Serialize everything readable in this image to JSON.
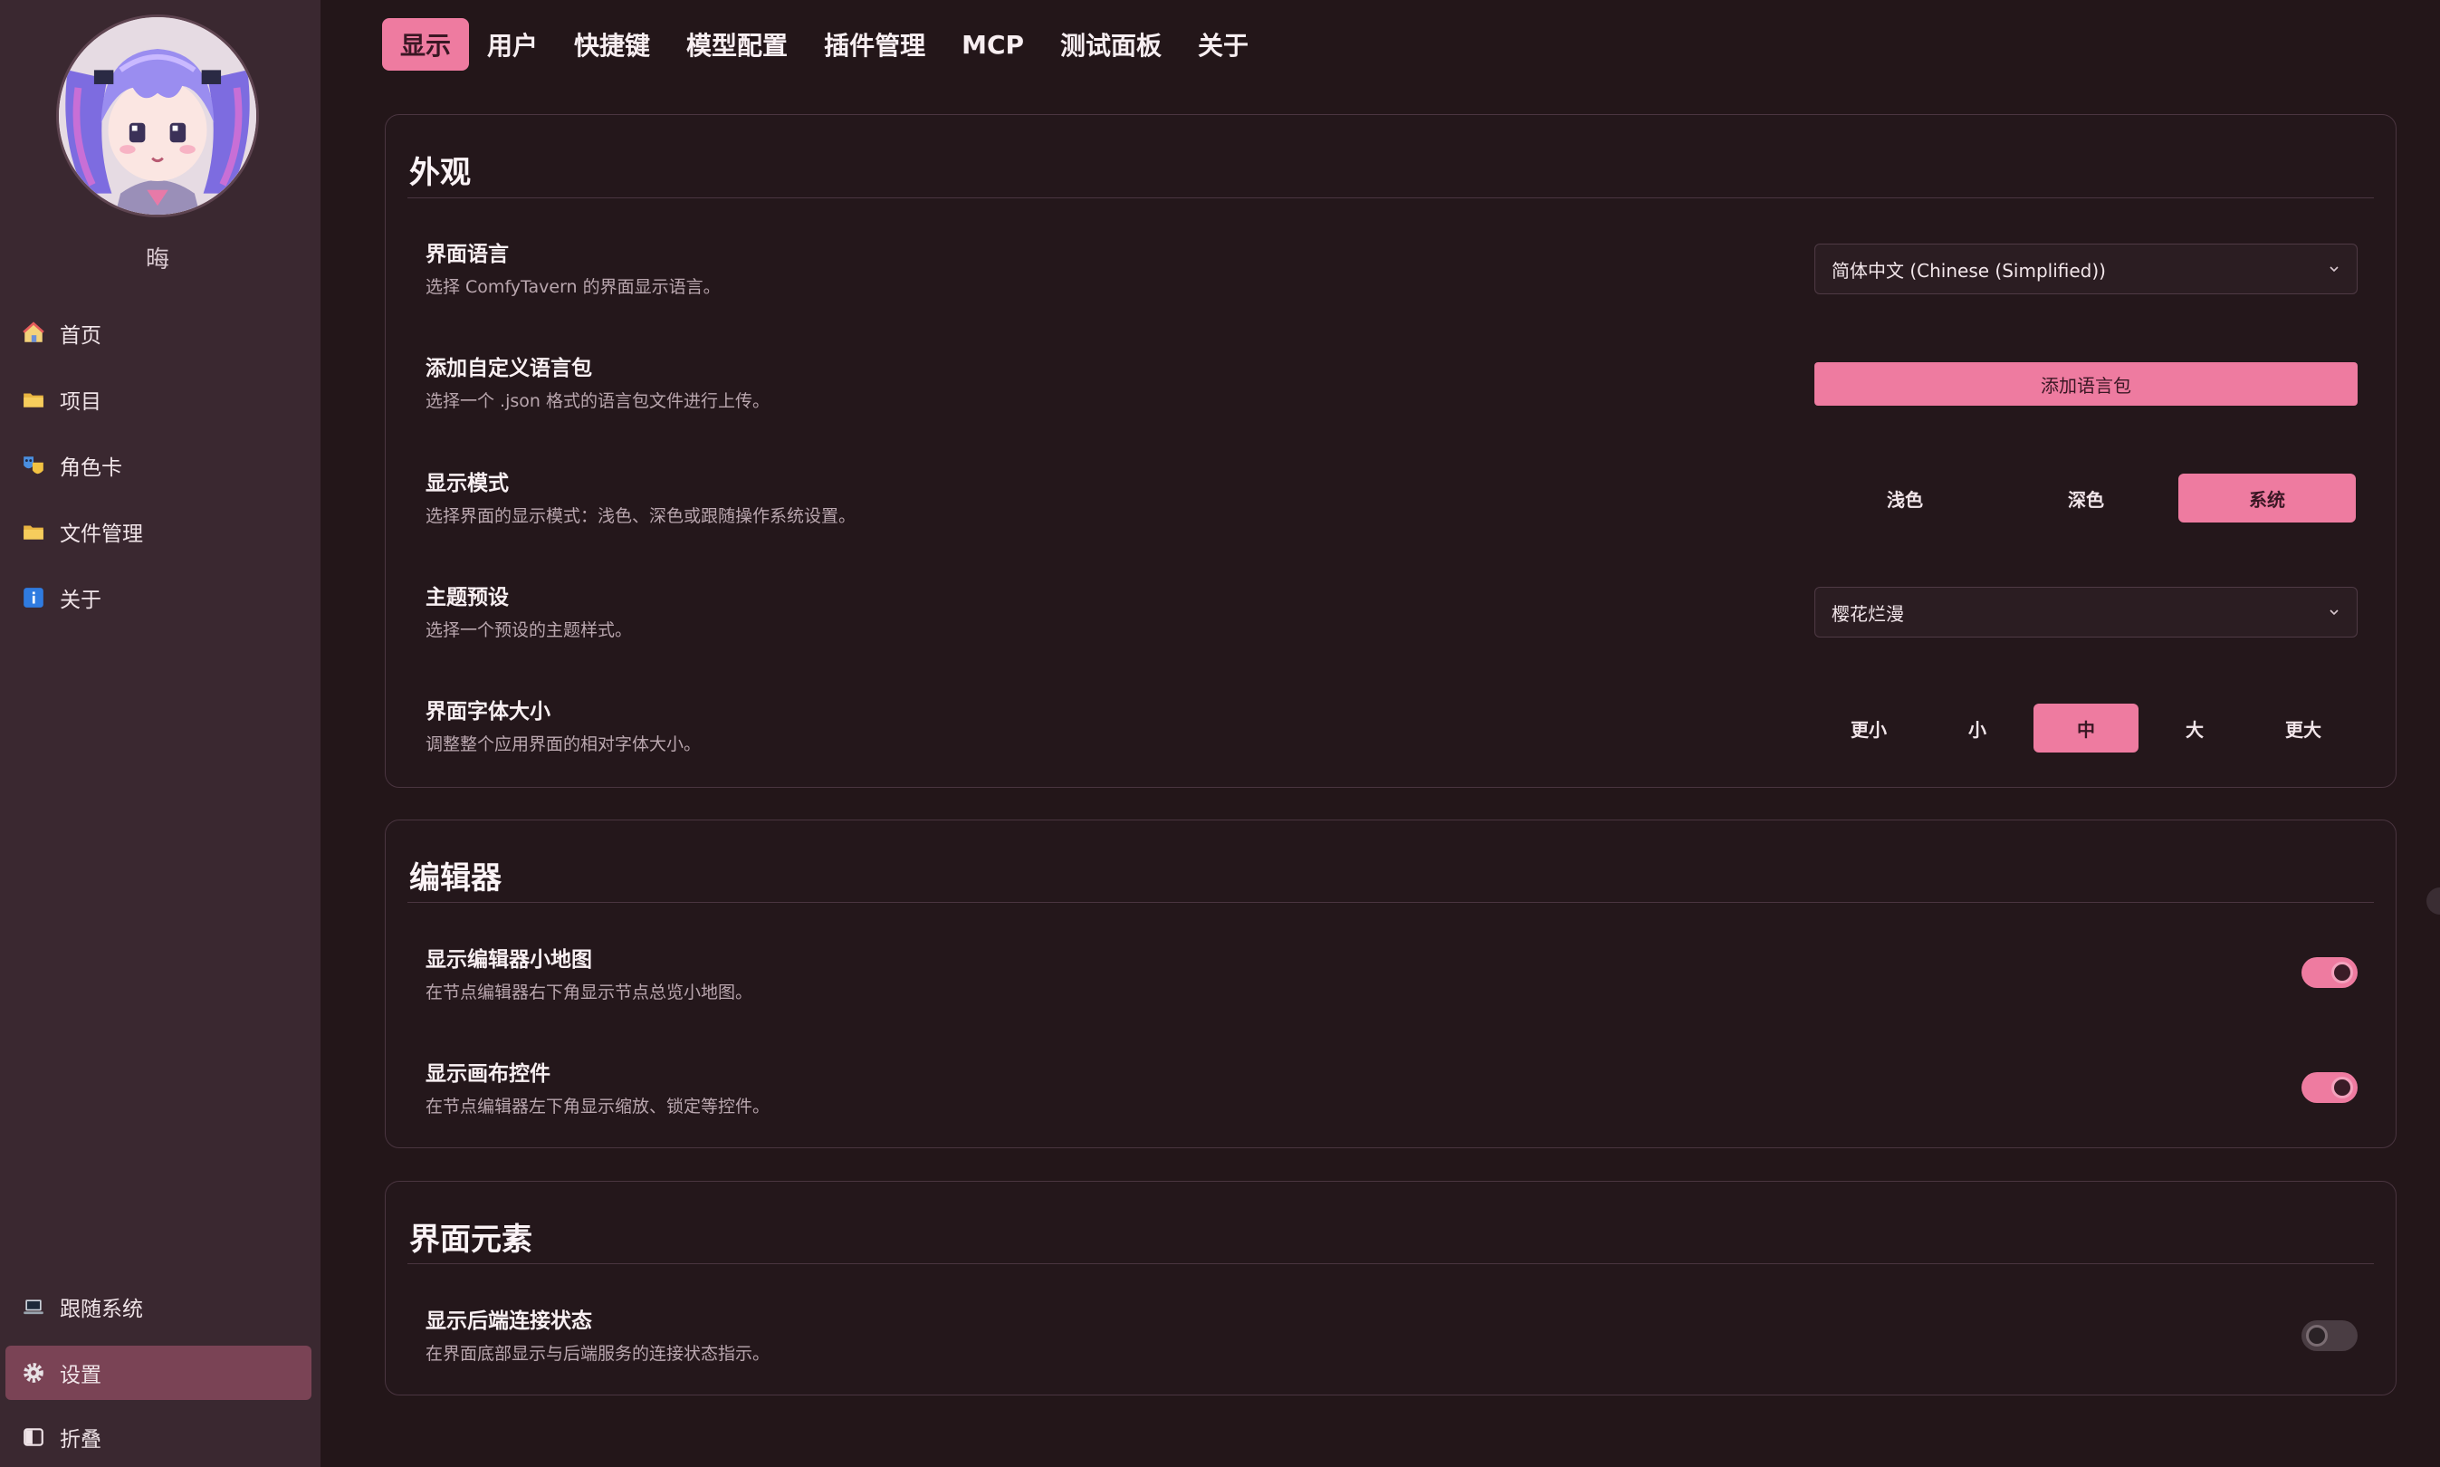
{
  "colors": {
    "accent": "#ee7ba0",
    "sidebar_bg": "#3a2830",
    "page_bg": "#231619",
    "active_nav_bg": "#7a4355"
  },
  "sidebar": {
    "username": "晦",
    "items": [
      {
        "label": "首页",
        "icon": "home-icon"
      },
      {
        "label": "项目",
        "icon": "folder-icon"
      },
      {
        "label": "角色卡",
        "icon": "theater-masks-icon"
      },
      {
        "label": "文件管理",
        "icon": "folder-icon"
      },
      {
        "label": "关于",
        "icon": "info-icon"
      }
    ],
    "bottom_items": [
      {
        "label": "跟随系统",
        "icon": "laptop-icon"
      },
      {
        "label": "设置",
        "icon": "gear-icon",
        "active": true
      },
      {
        "label": "折叠",
        "icon": "sidebar-collapse-icon"
      }
    ]
  },
  "tabs": [
    {
      "label": "显示",
      "active": true
    },
    {
      "label": "用户"
    },
    {
      "label": "快捷键"
    },
    {
      "label": "模型配置"
    },
    {
      "label": "插件管理"
    },
    {
      "label": "MCP"
    },
    {
      "label": "测试面板"
    },
    {
      "label": "关于"
    }
  ],
  "appearance": {
    "title": "外观",
    "language": {
      "title": "界面语言",
      "desc": "选择 ComfyTavern 的界面显示语言。",
      "value": "简体中文 (Chinese (Simplified))"
    },
    "langpack": {
      "title": "添加自定义语言包",
      "desc": "选择一个 .json 格式的语言包文件进行上传。",
      "button": "添加语言包"
    },
    "mode": {
      "title": "显示模式",
      "desc": "选择界面的显示模式：浅色、深色或跟随操作系统设置。",
      "options": [
        "浅色",
        "深色",
        "系统"
      ],
      "selected": "系统"
    },
    "theme": {
      "title": "主题预设",
      "desc": "选择一个预设的主题样式。",
      "value": "樱花烂漫"
    },
    "fontsize": {
      "title": "界面字体大小",
      "desc": "调整整个应用界面的相对字体大小。",
      "options": [
        "更小",
        "小",
        "中",
        "大",
        "更大"
      ],
      "selected": "中"
    }
  },
  "editor": {
    "title": "编辑器",
    "minimap": {
      "title": "显示编辑器小地图",
      "desc": "在节点编辑器右下角显示节点总览小地图。",
      "enabled": true
    },
    "canvas_controls": {
      "title": "显示画布控件",
      "desc": "在节点编辑器左下角显示缩放、锁定等控件。",
      "enabled": true
    }
  },
  "ui_elements": {
    "title": "界面元素",
    "backend_status": {
      "title": "显示后端连接状态",
      "desc": "在界面底部显示与后端服务的连接状态指示。",
      "enabled": false
    }
  }
}
